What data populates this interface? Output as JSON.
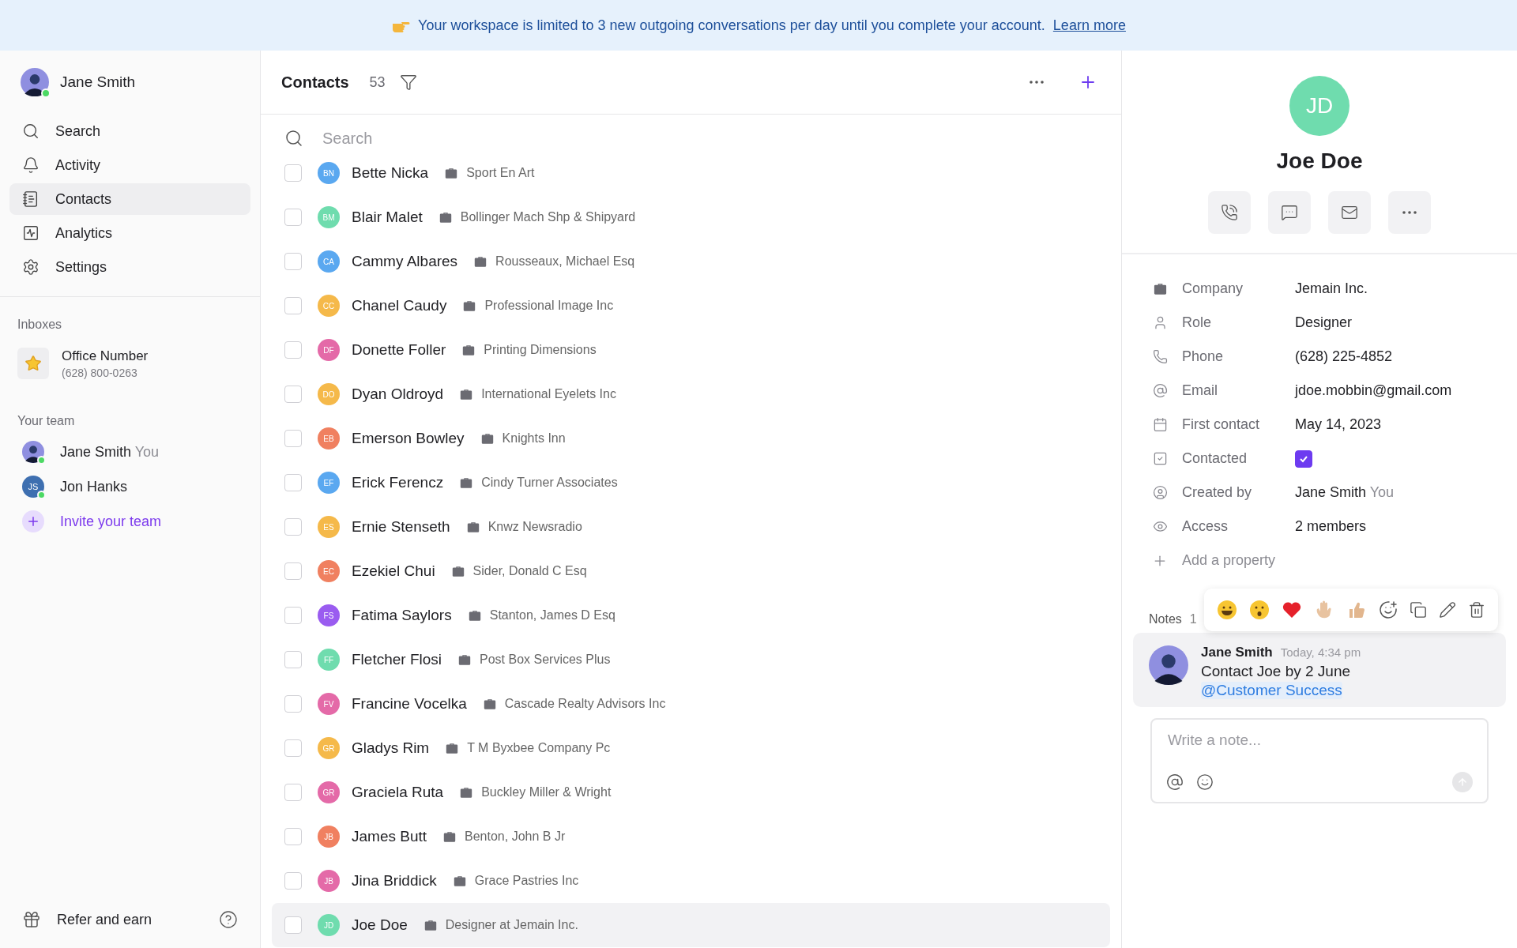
{
  "banner": {
    "text": "Your workspace is limited to 3 new outgoing conversations per day until you complete your account.",
    "link": "Learn more"
  },
  "sidebar": {
    "user": {
      "name": "Jane Smith",
      "online": true
    },
    "nav": [
      {
        "label": "Search",
        "selected": false
      },
      {
        "label": "Activity",
        "selected": false
      },
      {
        "label": "Contacts",
        "selected": true
      },
      {
        "label": "Analytics",
        "selected": false
      },
      {
        "label": "Settings",
        "selected": false
      }
    ],
    "inboxes": {
      "title": "Inboxes",
      "items": [
        {
          "name": "Office Number",
          "phone": "(628) 800-0263"
        }
      ]
    },
    "team": {
      "title": "Your team",
      "members": [
        {
          "kind": "photo",
          "name": "Jane Smith",
          "tag": "You",
          "online": true
        },
        {
          "kind": "initials",
          "initials": "JS",
          "name": "Jon Hanks",
          "online": true
        }
      ],
      "invite": "Invite your team"
    },
    "footer": {
      "label": "Refer and earn"
    }
  },
  "contacts": {
    "title": "Contacts",
    "count": "53",
    "search_placeholder": "Search",
    "rows": [
      {
        "initials": "BN",
        "name": "Bette Nicka",
        "company": "Sport En Art",
        "color": "#5aa8f0",
        "checked": false,
        "selected": false
      },
      {
        "initials": "BM",
        "name": "Blair Malet",
        "company": "Bollinger Mach Shp & Shipyard",
        "color": "#6fdcae",
        "checked": false,
        "selected": false
      },
      {
        "initials": "CA",
        "name": "Cammy Albares",
        "company": "Rousseaux, Michael Esq",
        "color": "#5aa8f0",
        "checked": false,
        "selected": false
      },
      {
        "initials": "CC",
        "name": "Chanel Caudy",
        "company": "Professional Image Inc",
        "color": "#f5b94a",
        "checked": false,
        "selected": false
      },
      {
        "initials": "DF",
        "name": "Donette Foller",
        "company": "Printing Dimensions",
        "color": "#e46aa8",
        "checked": false,
        "selected": false
      },
      {
        "initials": "DO",
        "name": "Dyan Oldroyd",
        "company": "International Eyelets Inc",
        "color": "#f5b94a",
        "checked": false,
        "selected": false
      },
      {
        "initials": "EB",
        "name": "Emerson Bowley",
        "company": "Knights Inn",
        "color": "#f08060",
        "checked": false,
        "selected": false
      },
      {
        "initials": "EF",
        "name": "Erick Ferencz",
        "company": "Cindy Turner Associates",
        "color": "#5aa8f0",
        "checked": false,
        "selected": false
      },
      {
        "initials": "ES",
        "name": "Ernie Stenseth",
        "company": "Knwz Newsradio",
        "color": "#f5b94a",
        "checked": false,
        "selected": false
      },
      {
        "initials": "EC",
        "name": "Ezekiel Chui",
        "company": "Sider, Donald C Esq",
        "color": "#f08060",
        "checked": false,
        "selected": false
      },
      {
        "initials": "FS",
        "name": "Fatima Saylors",
        "company": "Stanton, James D Esq",
        "color": "#9a5cf0",
        "checked": false,
        "selected": false
      },
      {
        "initials": "FF",
        "name": "Fletcher Flosi",
        "company": "Post Box Services Plus",
        "color": "#6fdcae",
        "checked": false,
        "selected": false
      },
      {
        "initials": "FV",
        "name": "Francine Vocelka",
        "company": "Cascade Realty Advisors Inc",
        "color": "#e46aa8",
        "checked": false,
        "selected": false
      },
      {
        "initials": "GR",
        "name": "Gladys Rim",
        "company": "T M Byxbee Company Pc",
        "color": "#f5b94a",
        "checked": false,
        "selected": false
      },
      {
        "initials": "GR",
        "name": "Graciela Ruta",
        "company": "Buckley Miller & Wright",
        "color": "#e46aa8",
        "checked": false,
        "selected": false
      },
      {
        "initials": "JB",
        "name": "James Butt",
        "company": "Benton, John B Jr",
        "color": "#f08060",
        "checked": false,
        "selected": false
      },
      {
        "initials": "JB",
        "name": "Jina Briddick",
        "company": "Grace Pastries Inc",
        "color": "#e46aa8",
        "checked": false,
        "selected": false
      },
      {
        "initials": "JD",
        "name": "Joe Doe",
        "company": "Designer at Jemain Inc.",
        "color": "#6fdcae",
        "checked": false,
        "selected": true
      }
    ]
  },
  "detail": {
    "initials": "JD",
    "name": "Joe Doe",
    "properties": [
      {
        "kind": "text",
        "label": "Company",
        "value": "Jemain Inc."
      },
      {
        "kind": "text",
        "label": "Role",
        "value": "Designer"
      },
      {
        "kind": "text",
        "label": "Phone",
        "value": "(628) 225-4852"
      },
      {
        "kind": "text",
        "label": "Email",
        "value": "jdoe.mobbin@gmail.com"
      },
      {
        "kind": "text",
        "label": "First contact",
        "value": "May 14, 2023"
      },
      {
        "kind": "checkbox",
        "label": "Contacted",
        "checked": true
      },
      {
        "kind": "user",
        "label": "Created by",
        "value": "Jane Smith",
        "tag": "You"
      },
      {
        "kind": "text",
        "label": "Access",
        "value": "2 members"
      }
    ],
    "add_property": "Add a property",
    "notes": {
      "title": "Notes",
      "count": "1",
      "items": [
        {
          "author": "Jane Smith",
          "time": "Today, 4:34 pm",
          "text": "Contact Joe by 2 June",
          "mention": "@Customer Success"
        }
      ],
      "placeholder": "Write a note..."
    }
  }
}
